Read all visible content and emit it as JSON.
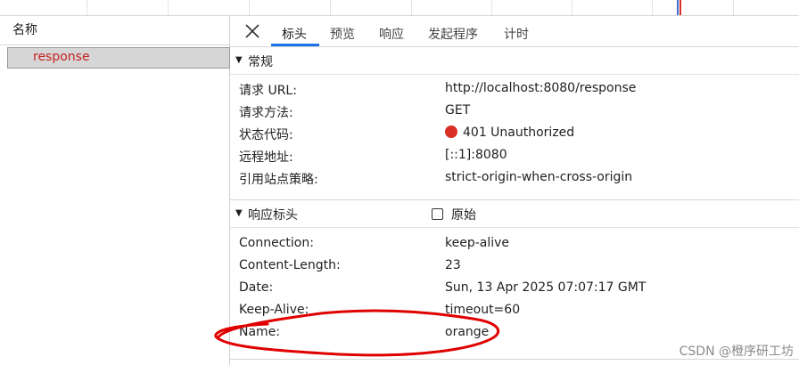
{
  "left_panel": {
    "header": "名称",
    "requests": [
      {
        "name": "response"
      }
    ]
  },
  "tabs": [
    {
      "label": "标头",
      "active": true
    },
    {
      "label": "预览",
      "active": false
    },
    {
      "label": "响应",
      "active": false
    },
    {
      "label": "发起程序",
      "active": false
    },
    {
      "label": "计时",
      "active": false
    }
  ],
  "general": {
    "title": "常规",
    "rows": [
      {
        "key": "请求 URL:",
        "value": "http://localhost:8080/response"
      },
      {
        "key": "请求方法:",
        "value": "GET"
      },
      {
        "key": "状态代码:",
        "value": "401 Unauthorized"
      },
      {
        "key": "远程地址:",
        "value": "[::1]:8080"
      },
      {
        "key": "引用站点策略:",
        "value": "strict-origin-when-cross-origin"
      }
    ]
  },
  "response_headers": {
    "title": "响应标头",
    "raw_label": "原始",
    "raw_checked": false,
    "rows": [
      {
        "key": "Connection:",
        "value": "keep-alive"
      },
      {
        "key": "Content-Length:",
        "value": "23"
      },
      {
        "key": "Date:",
        "value": "Sun, 13 Apr 2025 07:07:17 GMT"
      },
      {
        "key": "Keep-Alive:",
        "value": "timeout=60"
      },
      {
        "key": "Name:",
        "value": "orange"
      }
    ]
  },
  "colors": {
    "status_error": "#d93025",
    "active_tab_underline": "#1a73e8",
    "annotation": "#e00000"
  },
  "watermark": "CSDN @橙序研工坊"
}
